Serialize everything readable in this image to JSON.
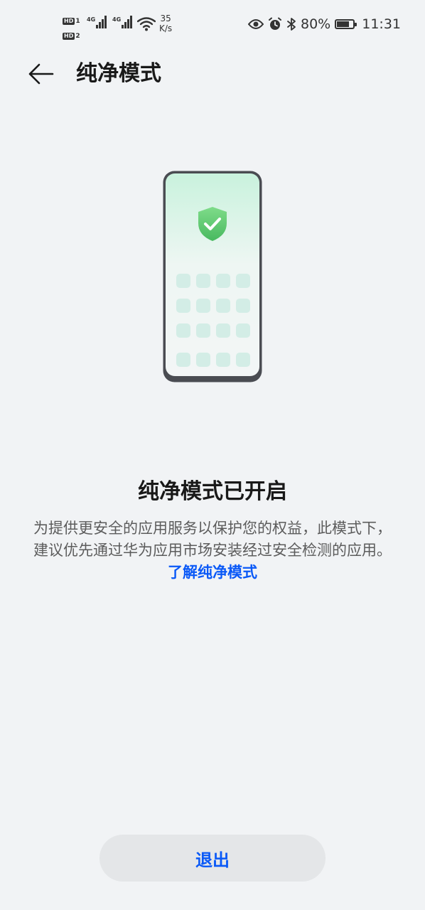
{
  "status_bar": {
    "sim1": "HD",
    "sim1_index": "1",
    "sim2": "HD",
    "sim2_index": "2",
    "network1": "4G",
    "network2": "4G",
    "speed_value": "35",
    "speed_unit": "K/s",
    "battery_percent": "80%",
    "battery_level": 0.8,
    "time": "11:31",
    "icons": [
      "eye-icon",
      "alarm-icon",
      "bluetooth-icon",
      "battery-icon",
      "wifi-icon",
      "signal-icon"
    ]
  },
  "header": {
    "title": "纯净模式"
  },
  "main": {
    "headline": "纯净模式已开启",
    "description": "为提供更安全的应用服务以保护您的权益，此模式下，建议优先通过华为应用市场安装经过安全检测的应用。",
    "learn_more": "了解纯净模式",
    "illustration_icon": "shield-check-icon"
  },
  "footer": {
    "exit_label": "退出"
  },
  "colors": {
    "accent": "#0a59f7",
    "background": "#f1f3f5",
    "shield": "#5fc76e"
  }
}
